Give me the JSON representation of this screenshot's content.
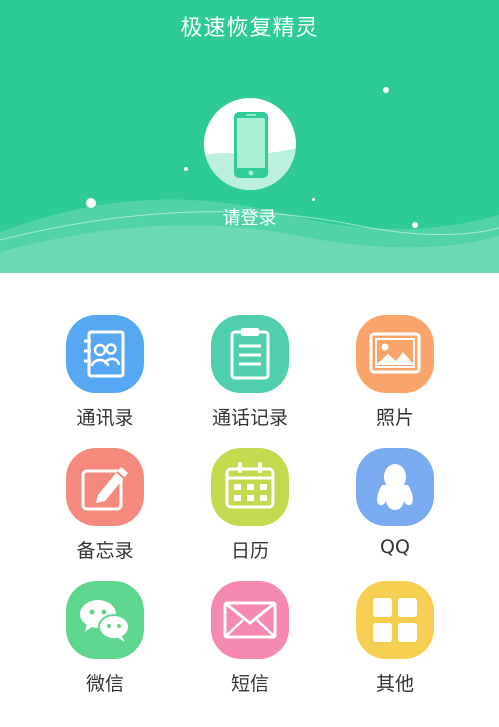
{
  "app": {
    "title": "极速恢复精灵"
  },
  "profile": {
    "login_label": "请登录",
    "icon": "phone-icon"
  },
  "grid": [
    {
      "label": "通讯录",
      "icon": "contacts-icon",
      "color": "#57a8f2"
    },
    {
      "label": "通话记录",
      "icon": "call-log-icon",
      "color": "#4fcfae"
    },
    {
      "label": "照片",
      "icon": "photo-icon",
      "color": "#f9a46b"
    },
    {
      "label": "备忘录",
      "icon": "memo-icon",
      "color": "#f48a7e"
    },
    {
      "label": "日历",
      "icon": "calendar-icon",
      "color": "#c4d94d"
    },
    {
      "label": "QQ",
      "icon": "qq-icon",
      "color": "#7aabf1"
    },
    {
      "label": "微信",
      "icon": "wechat-icon",
      "color": "#5fd68e"
    },
    {
      "label": "短信",
      "icon": "sms-icon",
      "color": "#f589b1"
    },
    {
      "label": "其他",
      "icon": "other-icon",
      "color": "#f6cf52"
    }
  ],
  "theme": {
    "header_color": "#2ecb97"
  }
}
